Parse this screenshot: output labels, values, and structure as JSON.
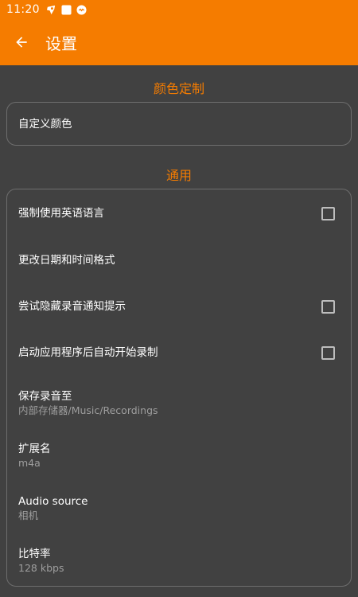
{
  "status_bar": {
    "time": "11:20",
    "icons": [
      "notification-app-icon",
      "square-notification-icon",
      "badge-notification-icon"
    ]
  },
  "toolbar": {
    "back_icon": "arrow-left-icon",
    "title": "设置"
  },
  "sections": {
    "color": {
      "title": "颜色定制",
      "items": [
        {
          "title": "自定义颜色"
        }
      ]
    },
    "general": {
      "title": "通用",
      "items": [
        {
          "title": "强制使用英语语言",
          "checked": false
        },
        {
          "title": "更改日期和时间格式"
        },
        {
          "title": "尝试隐藏录音通知提示",
          "checked": false
        },
        {
          "title": "启动应用程序后自动开始录制",
          "checked": false
        },
        {
          "title": "保存录音至",
          "summary": "内部存储器/Music/Recordings"
        },
        {
          "title": "扩展名",
          "summary": "m4a"
        },
        {
          "title": "Audio source",
          "summary": "相机"
        },
        {
          "title": "比特率",
          "summary": "128 kbps"
        }
      ]
    }
  },
  "colors": {
    "accent": "#f57c00",
    "background": "#414141",
    "card_border": "#6e6e6e",
    "summary_text": "#9e9e9e"
  }
}
